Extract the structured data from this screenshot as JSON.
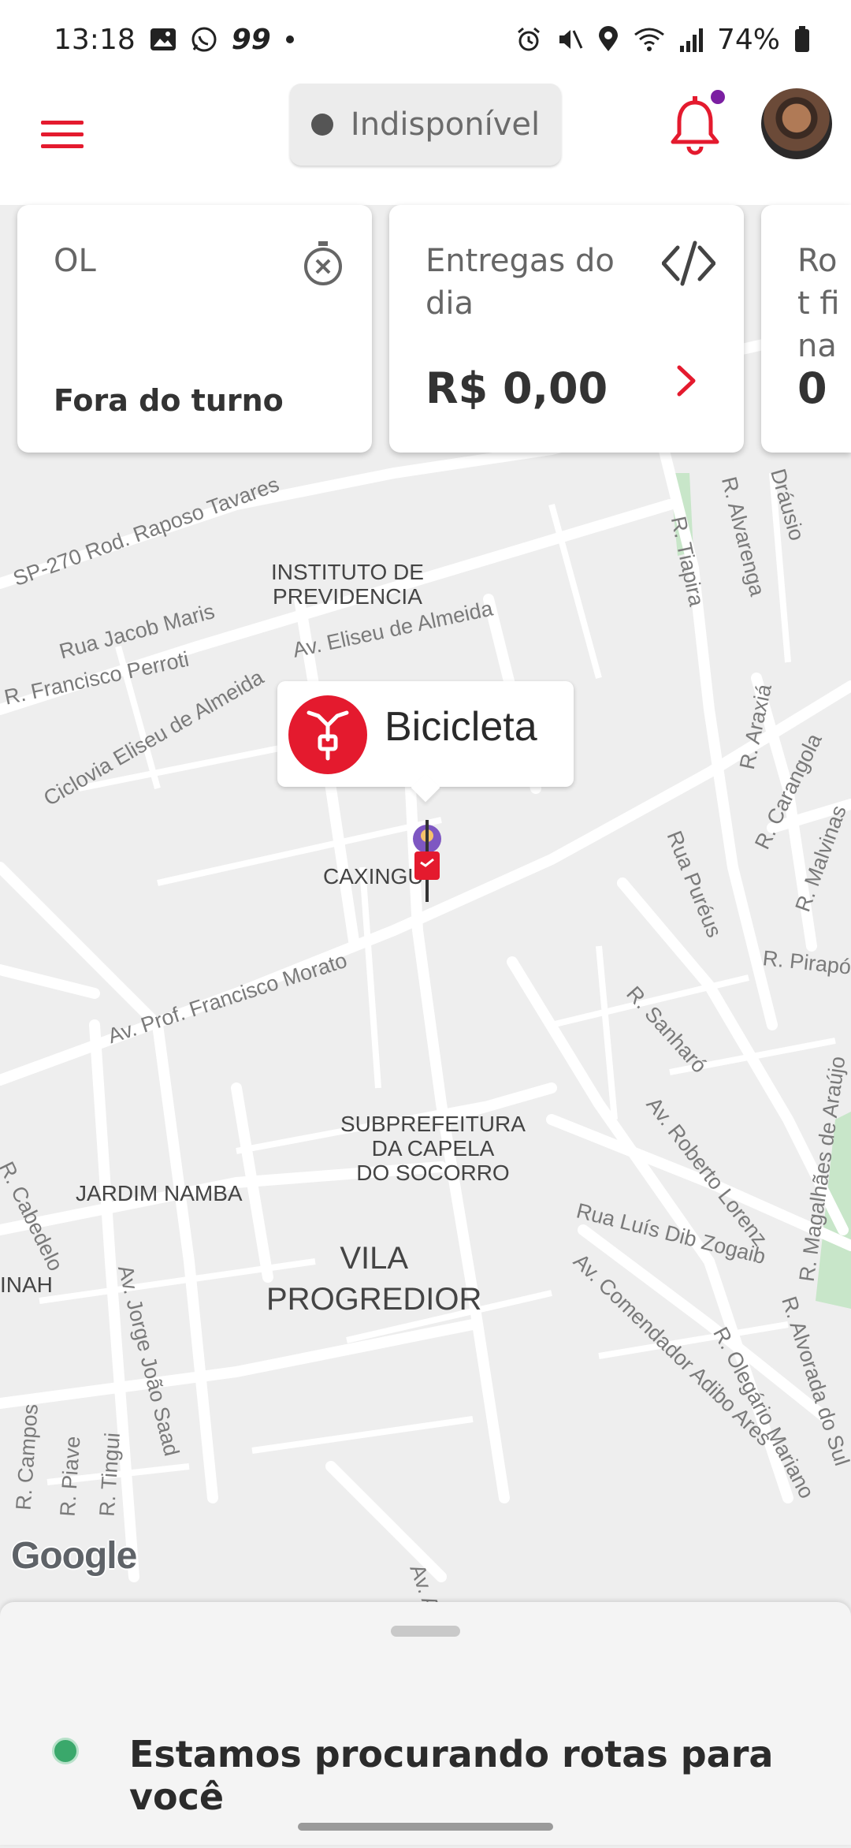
{
  "status_bar": {
    "time": "13:18",
    "notification_icons": [
      "image-icon",
      "whatsapp-icon",
      "99-icon",
      "dot-icon"
    ],
    "app_99_label": "99",
    "battery": "74%",
    "system_icons": [
      "alarm-icon",
      "mute-icon",
      "location-icon",
      "wifi-icon",
      "signal-icon",
      "battery-icon"
    ]
  },
  "header": {
    "availability_label": "Indisponível",
    "accent_color": "#e41a2e",
    "notification_badge_color": "#7b1fa2"
  },
  "cards": [
    {
      "title": "OL",
      "value": "Fora do turno",
      "icon": "timer-off-icon"
    },
    {
      "title": "Entregas do dia",
      "value": "R$ 0,00",
      "icon": "eye-off-icon",
      "action_icon": "chevron-right-icon"
    },
    {
      "title": "Rot fina",
      "value": "0"
    }
  ],
  "map": {
    "labels": {
      "sp270": "SP-270 Rod. Raposo Tavares",
      "jacob": "Rua Jacob Maris",
      "perroti": "R. Francisco Perroti",
      "ciclovia": "Ciclovia Eliseu de Almeida",
      "eliseu": "Av. Eliseu de Almeida",
      "instituto_1": "INSTITUTO DE",
      "instituto_2": "PREVIDENCIA",
      "tiapira": "R. Tiapira",
      "alvarenga": "R. Alvarenga",
      "drausio": "Dráusio",
      "araxia": "R. Araxiá",
      "carangola": "R. Carangola",
      "malvinas": "R. Malvinas",
      "pureus": "Rua Puréus",
      "pirapo": "R. Pirapó",
      "caxingui": "CAXINGUI",
      "morato": "Av. Prof. Francisco Morato",
      "sanharo": "R. Sanharó",
      "lorenz": "Av. Roberto Lorenz",
      "magalhaes": "R. Magalhães de Araújo",
      "sub_1": "SUBPREFEITURA",
      "sub_2": "DA CAPELA",
      "sub_3": "DO SOCORRO",
      "jardim_namba": "JARDIM NAMBA",
      "cabedelo": "R. Cabedelo",
      "inah": "INAH",
      "jorge": "Av. Jorge João Saad",
      "vila_1": "VILA",
      "vila_2": "PROGREDIOR",
      "dib": "Rua Luís Dib Zogaib",
      "adibo": "Av. Comendador Adibo Ares",
      "olegario": "R. Olegário Mariano",
      "alvorada": "R. Alvorada do Sul",
      "campos": "R. Campos",
      "piave": "R. Piave",
      "tingui": "R. Tingui",
      "av_al": "Av. Al"
    },
    "attribution": "Google"
  },
  "vehicle": {
    "label": "Bicicleta",
    "icon": "bicycle-icon"
  },
  "bottom_sheet": {
    "message": "Estamos procurando rotas para você",
    "status_color": "#3aa86b"
  }
}
